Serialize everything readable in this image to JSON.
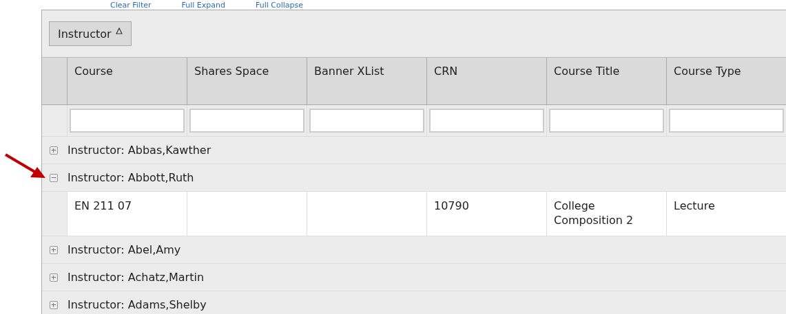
{
  "toolbar_links": [
    "Clear Filter",
    "Full Expand",
    "Full Collapse"
  ],
  "group_panel": {
    "chips": [
      {
        "label": "Instructor",
        "ascending": true
      }
    ]
  },
  "table": {
    "columns": [
      "Course",
      "Shares Space",
      "Banner XList",
      "CRN",
      "Course Title",
      "Course Type"
    ],
    "groups": [
      {
        "label": "Instructor: Abbas,Kawther",
        "expanded": false,
        "pointed_at": false
      },
      {
        "label": "Instructor: Abbott,Ruth",
        "expanded": true,
        "pointed_at": true,
        "rows": [
          {
            "cells": [
              "EN 211 07",
              null,
              null,
              "10790",
              "College Composition 2",
              "Lecture"
            ]
          }
        ]
      },
      {
        "label": "Instructor: Abel,Amy",
        "expanded": false,
        "pointed_at": false
      },
      {
        "label": "Instructor: Achatz,Martin",
        "expanded": false,
        "pointed_at": false
      },
      {
        "label": "Instructor: Adams,Shelby",
        "expanded": false,
        "pointed_at": false
      }
    ]
  }
}
